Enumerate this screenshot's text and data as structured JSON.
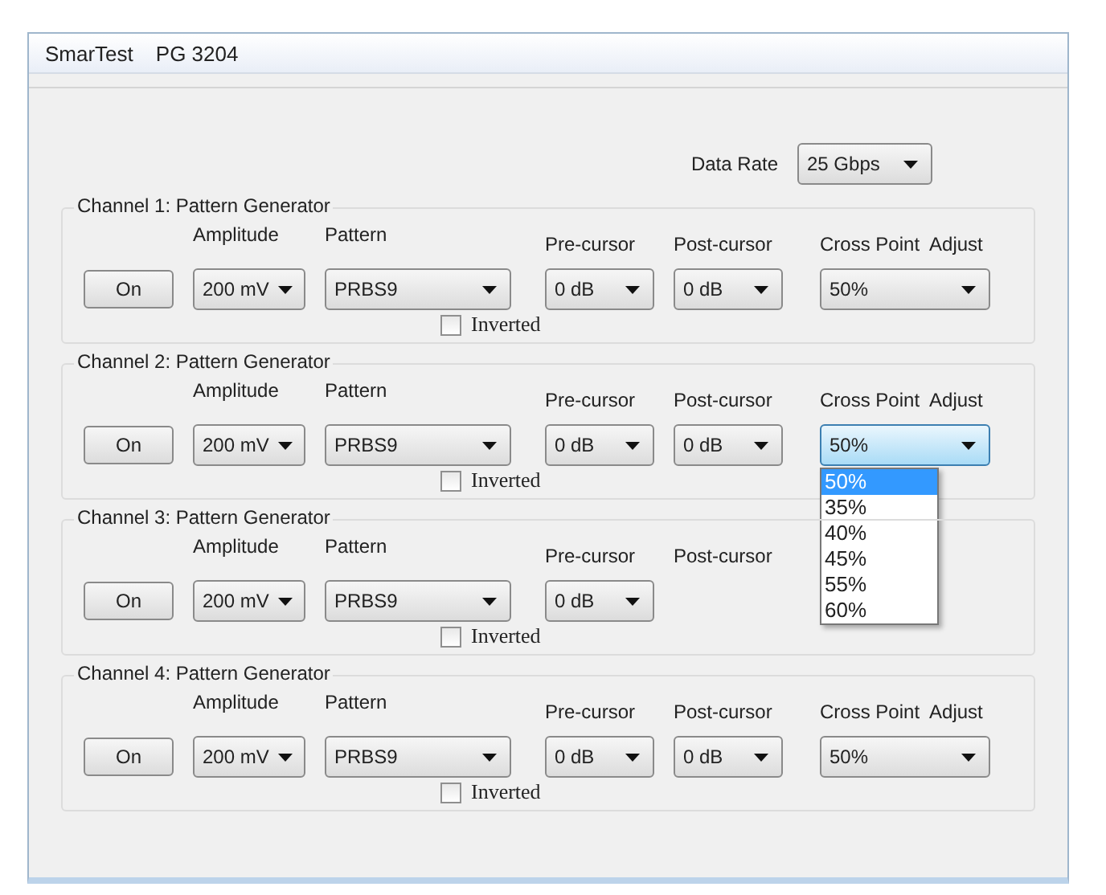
{
  "window": {
    "title": "SmarTest",
    "subtitle": "PG 3204"
  },
  "data_rate": {
    "label": "Data Rate",
    "value": "25 Gbps"
  },
  "channels": [
    {
      "title": "Channel 1:  Pattern Generator",
      "button": "On",
      "amplitude": {
        "label": "Amplitude",
        "value": "200 mV"
      },
      "pattern": {
        "label": "Pattern",
        "value": "PRBS9"
      },
      "inverted": {
        "label": "Inverted",
        "checked": false
      },
      "pre_cursor": {
        "label": "Pre-cursor",
        "value": "0 dB"
      },
      "post_cursor": {
        "label": "Post-cursor",
        "value": "0 dB"
      },
      "cross_point": {
        "label": "Cross Point  Adjust",
        "value": "50%",
        "expanded": false
      }
    },
    {
      "title": "Channel 2:  Pattern Generator",
      "button": "On",
      "amplitude": {
        "label": "Amplitude",
        "value": "200 mV"
      },
      "pattern": {
        "label": "Pattern",
        "value": "PRBS9"
      },
      "inverted": {
        "label": "Inverted",
        "checked": false
      },
      "pre_cursor": {
        "label": "Pre-cursor",
        "value": "0 dB"
      },
      "post_cursor": {
        "label": "Post-cursor",
        "value": "0 dB"
      },
      "cross_point": {
        "label": "Cross Point  Adjust",
        "value": "50%",
        "expanded": true,
        "options": [
          {
            "label": "50%",
            "selected": true
          },
          {
            "label": "35%",
            "selected": false
          },
          {
            "label": "40%",
            "selected": false
          },
          {
            "label": "45%",
            "selected": false
          },
          {
            "label": "55%",
            "selected": false
          },
          {
            "label": "60%",
            "selected": false
          }
        ]
      }
    },
    {
      "title": "Channel 3:  Pattern Generator",
      "button": "On",
      "amplitude": {
        "label": "Amplitude",
        "value": "200 mV"
      },
      "pattern": {
        "label": "Pattern",
        "value": "PRBS9"
      },
      "inverted": {
        "label": "Inverted",
        "checked": false
      },
      "pre_cursor": {
        "label": "Pre-cursor",
        "value": "0 dB"
      },
      "post_cursor": {
        "label": "Post-cursor"
      }
    },
    {
      "title": "Channel 4:  Pattern Generator",
      "button": "On",
      "amplitude": {
        "label": "Amplitude",
        "value": "200 mV"
      },
      "pattern": {
        "label": "Pattern",
        "value": "PRBS9"
      },
      "inverted": {
        "label": "Inverted",
        "checked": false
      },
      "pre_cursor": {
        "label": "Pre-cursor",
        "value": "0 dB"
      },
      "post_cursor": {
        "label": "Post-cursor",
        "value": "0 dB"
      },
      "cross_point": {
        "label": "Cross Point  Adjust",
        "value": "50%",
        "expanded": false
      }
    }
  ]
}
